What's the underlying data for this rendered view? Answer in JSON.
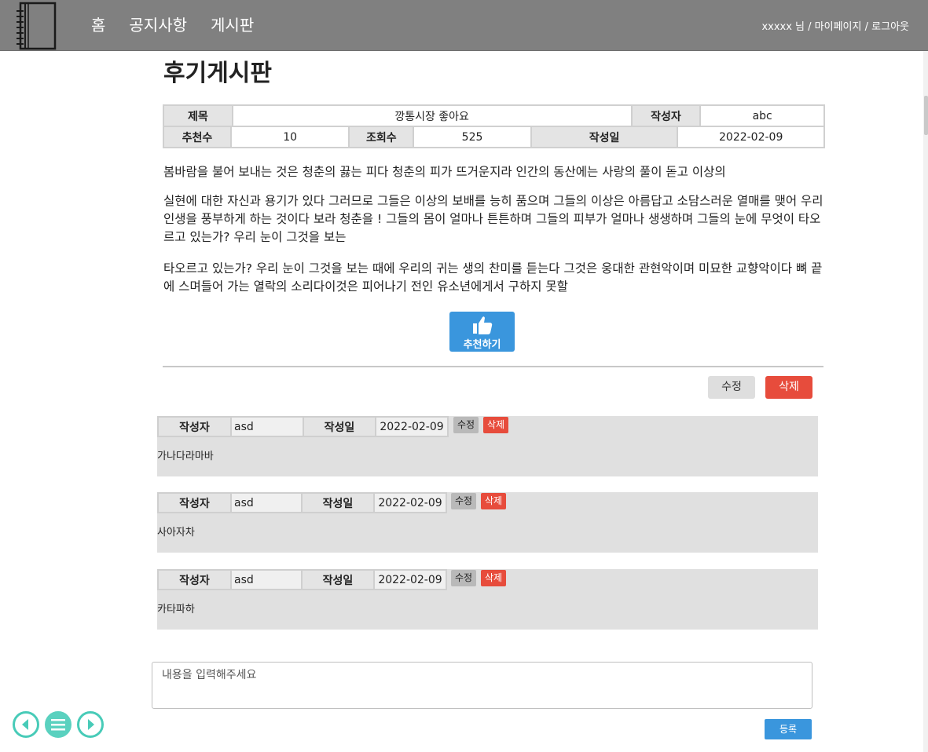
{
  "nav": {
    "home": "홈",
    "notice": "공지사항",
    "board": "게시판"
  },
  "user": {
    "name": "xxxxx 님",
    "sep1": "/",
    "mypage": "마이페이지",
    "sep2": "/",
    "logout": "로그아웃"
  },
  "page_title": "후기게시판",
  "post": {
    "labels": {
      "title": "제목",
      "author": "작성자",
      "likes": "추천수",
      "views": "조회수",
      "date": "작성일"
    },
    "title": "깡통시장 좋아요",
    "author": "abc",
    "likes": "10",
    "views": "525",
    "date": "2022-02-09",
    "paragraphs": [
      "봄바람을 불어 보내는 것은 청춘의 끓는 피다 청춘의 피가 뜨거운지라 인간의 동산에는 사랑의 풀이 돋고 이상의",
      "실현에 대한 자신과 용기가 있다 그러므로 그들은 이상의 보배를 능히 품으며 그들의 이상은 아름답고 소담스러운 열매를 맺어 우리 인생을 풍부하게 하는 것이다 보라 청춘을 ! 그들의 몸이 얼마나 튼튼하며 그들의 피부가 얼마나 생생하며 그들의 눈에 무엇이 타오르고 있는가? 우리 눈이 그것을 보는",
      "타오르고 있는가? 우리 눈이 그것을 보는 때에 우리의 귀는 생의 찬미를 듣는다 그것은 웅대한 관현악이며 미묘한 교향악이다 뼈 끝에 스며들어 가는 열락의 소리다이것은 피어나기 전인 유소년에게서 구하지 못할"
    ],
    "like_button": "추천하기",
    "edit_button": "수정",
    "delete_button": "삭제"
  },
  "comments": [
    {
      "author_label": "작성자",
      "author": "asd",
      "date_label": "작성일",
      "date": "2022-02-09",
      "edit": "수정",
      "delete": "삭제",
      "body": "가나다라마바"
    },
    {
      "author_label": "작성자",
      "author": "asd",
      "date_label": "작성일",
      "date": "2022-02-09",
      "edit": "수정",
      "delete": "삭제",
      "body": "사아자차"
    },
    {
      "author_label": "작성자",
      "author": "asd",
      "date_label": "작성일",
      "date": "2022-02-09",
      "edit": "수정",
      "delete": "삭제",
      "body": "카타파하"
    }
  ],
  "comment_input": {
    "placeholder": "내용을 입력해주세요",
    "submit": "등록"
  },
  "colors": {
    "header": "#808080",
    "accent_blue": "#3a96dd",
    "danger_red": "#e74c3c",
    "fab_teal": "#48cbb8"
  },
  "icons": {
    "logo": "notebook-icon",
    "like": "thumbs-up-icon",
    "prev": "arrow-left-circle-icon",
    "menu": "hamburger-menu-icon",
    "next": "arrow-right-circle-icon"
  }
}
